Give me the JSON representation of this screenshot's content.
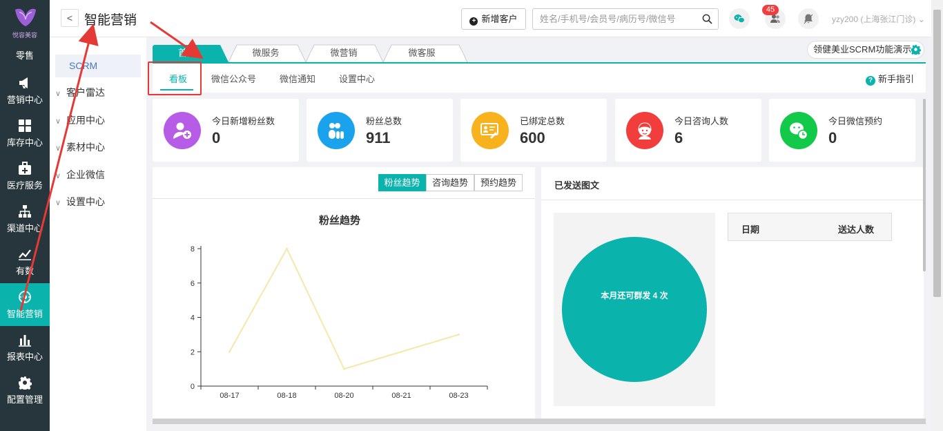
{
  "brand": {
    "logo_text": "悦容美容",
    "section": "零售"
  },
  "leftnav": [
    {
      "label": "营销中心",
      "icon": "megaphone-icon"
    },
    {
      "label": "库存中心",
      "icon": "grid-icon"
    },
    {
      "label": "医疗服务",
      "icon": "medical-kit-icon"
    },
    {
      "label": "渠道中心",
      "icon": "org-chart-icon"
    },
    {
      "label": "有数",
      "icon": "trend-line-icon"
    },
    {
      "label": "智能营销",
      "icon": "smart-marketing-icon",
      "active": true
    },
    {
      "label": "报表中心",
      "icon": "bar-chart-icon"
    },
    {
      "label": "配置管理",
      "icon": "gear-icon"
    }
  ],
  "header": {
    "back": "<",
    "title": "智能营销",
    "add_customer": "新增客户",
    "search_placeholder": "姓名/手机号/会员号/病历号/微信号",
    "notif_count": "45",
    "user": "yzy200 (上海张江门诊)"
  },
  "subnav": {
    "selected": "SCRM",
    "items": [
      "客户雷达",
      "应用中心",
      "素材中心",
      "企业微信",
      "设置中心"
    ]
  },
  "top_tabs": [
    "首页",
    "微服务",
    "微营销",
    "微客服"
  ],
  "demo_button": "领健美业SCRM功能演示",
  "sub_tabs": [
    "看板",
    "微信公众号",
    "微信通知",
    "设置中心"
  ],
  "guide": "新手指引",
  "stats": [
    {
      "title": "今日新增粉丝数",
      "value": "0",
      "color": "#b65ce6",
      "icon": "add-user-icon"
    },
    {
      "title": "粉丝总数",
      "value": "911",
      "color": "#1aa3ec",
      "icon": "users-group-icon"
    },
    {
      "title": "已绑定总数",
      "value": "600",
      "color": "#f7b21d",
      "icon": "id-card-link-icon"
    },
    {
      "title": "今日咨询人数",
      "value": "6",
      "color": "#f23d3d",
      "icon": "consultant-icon"
    },
    {
      "title": "今日微信预约",
      "value": "0",
      "color": "#12c94a",
      "icon": "wechat-clock-icon"
    }
  ],
  "trend_buttons": [
    "粉丝趋势",
    "咨询趋势",
    "预约趋势"
  ],
  "chart_data": {
    "type": "line",
    "title": "粉丝趋势",
    "categories": [
      "08-17",
      "08-18",
      "08-20",
      "08-21",
      "08-23"
    ],
    "values": [
      2,
      8,
      1,
      2,
      3
    ],
    "ylim": [
      0,
      8
    ],
    "yticks": [
      0,
      2,
      4,
      6,
      8
    ],
    "xlabel": "",
    "ylabel": "",
    "grid": false,
    "color": "#f7e7a8"
  },
  "sent_panel": {
    "title": "已发送图文",
    "pie_label": "本月还可群发 4 次",
    "columns": [
      "日期",
      "送达人数"
    ]
  },
  "colors": {
    "accent": "#0bb3ad",
    "nav_bg": "#27353c",
    "annotation": "#e53935"
  }
}
